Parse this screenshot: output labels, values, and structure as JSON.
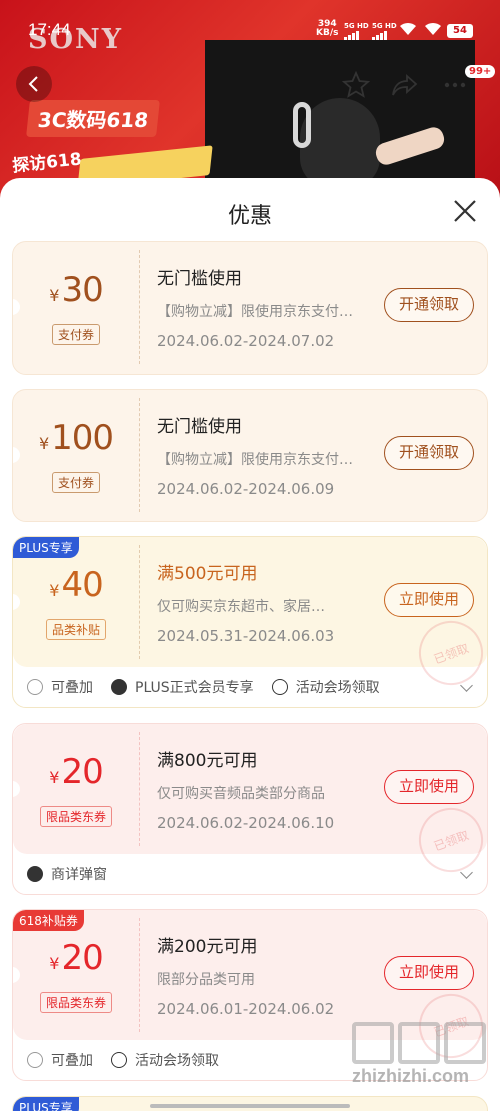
{
  "status_bar": {
    "time": "17:44",
    "speed_value": "394",
    "speed_unit": "KB/s",
    "sim1": "5G HD",
    "sim2": "5G HD",
    "battery": "54"
  },
  "banner": {
    "brand": "SONY",
    "promo": "3C数码618",
    "promo_sub": "探访618"
  },
  "nav": {
    "cart_badge": "99+"
  },
  "sheet": {
    "title": "优惠"
  },
  "coupons": [
    {
      "currency": "¥",
      "amount": "30",
      "tag": "支付券",
      "condition": "无门槛使用",
      "description": "【购物立减】限使用京东支付…",
      "dates": "2024.06.02-2024.07.02",
      "button": "开通领取",
      "style": "pay"
    },
    {
      "currency": "¥",
      "amount": "100",
      "tag": "支付券",
      "condition": "无门槛使用",
      "description": "【购物立减】限使用京东支付…",
      "dates": "2024.06.02-2024.06.09",
      "button": "开通领取",
      "style": "pay"
    },
    {
      "corner_tag": "PLUS专享",
      "currency": "¥",
      "amount": "40",
      "tag": "品类补贴",
      "condition": "满500元可用",
      "description": "仅可购买京东超市、家居…",
      "dates": "2024.05.31-2024.06.03",
      "button": "立即使用",
      "style": "plus",
      "stamp": "已领取",
      "footer": [
        "可叠加",
        "PLUS正式会员专享",
        "活动会场领取"
      ]
    },
    {
      "currency": "¥",
      "amount": "20",
      "tag": "限品类东券",
      "condition": "满800元可用",
      "description": "仅可购买音频品类部分商品",
      "dates": "2024.06.02-2024.06.10",
      "button": "立即使用",
      "style": "red",
      "stamp": "已领取",
      "footer": [
        "商详弹窗"
      ]
    },
    {
      "corner_tag": "618补贴券",
      "currency": "¥",
      "amount": "20",
      "tag": "限品类东券",
      "condition": "满200元可用",
      "description": "限部分品类可用",
      "dates": "2024.06.01-2024.06.02",
      "button": "立即使用",
      "style": "red",
      "stamp": "已领取",
      "footer": [
        "可叠加",
        "活动会场领取"
      ]
    }
  ],
  "next_corner_tag": "PLUS专享",
  "watermark": "zhizhizhi.com",
  "colors": {
    "pay_text": "#a0501e",
    "plus_text": "#c8641e",
    "red_text": "#e4262b",
    "plus_blue": "#2f5bd6",
    "tag_red": "#e83a36"
  }
}
